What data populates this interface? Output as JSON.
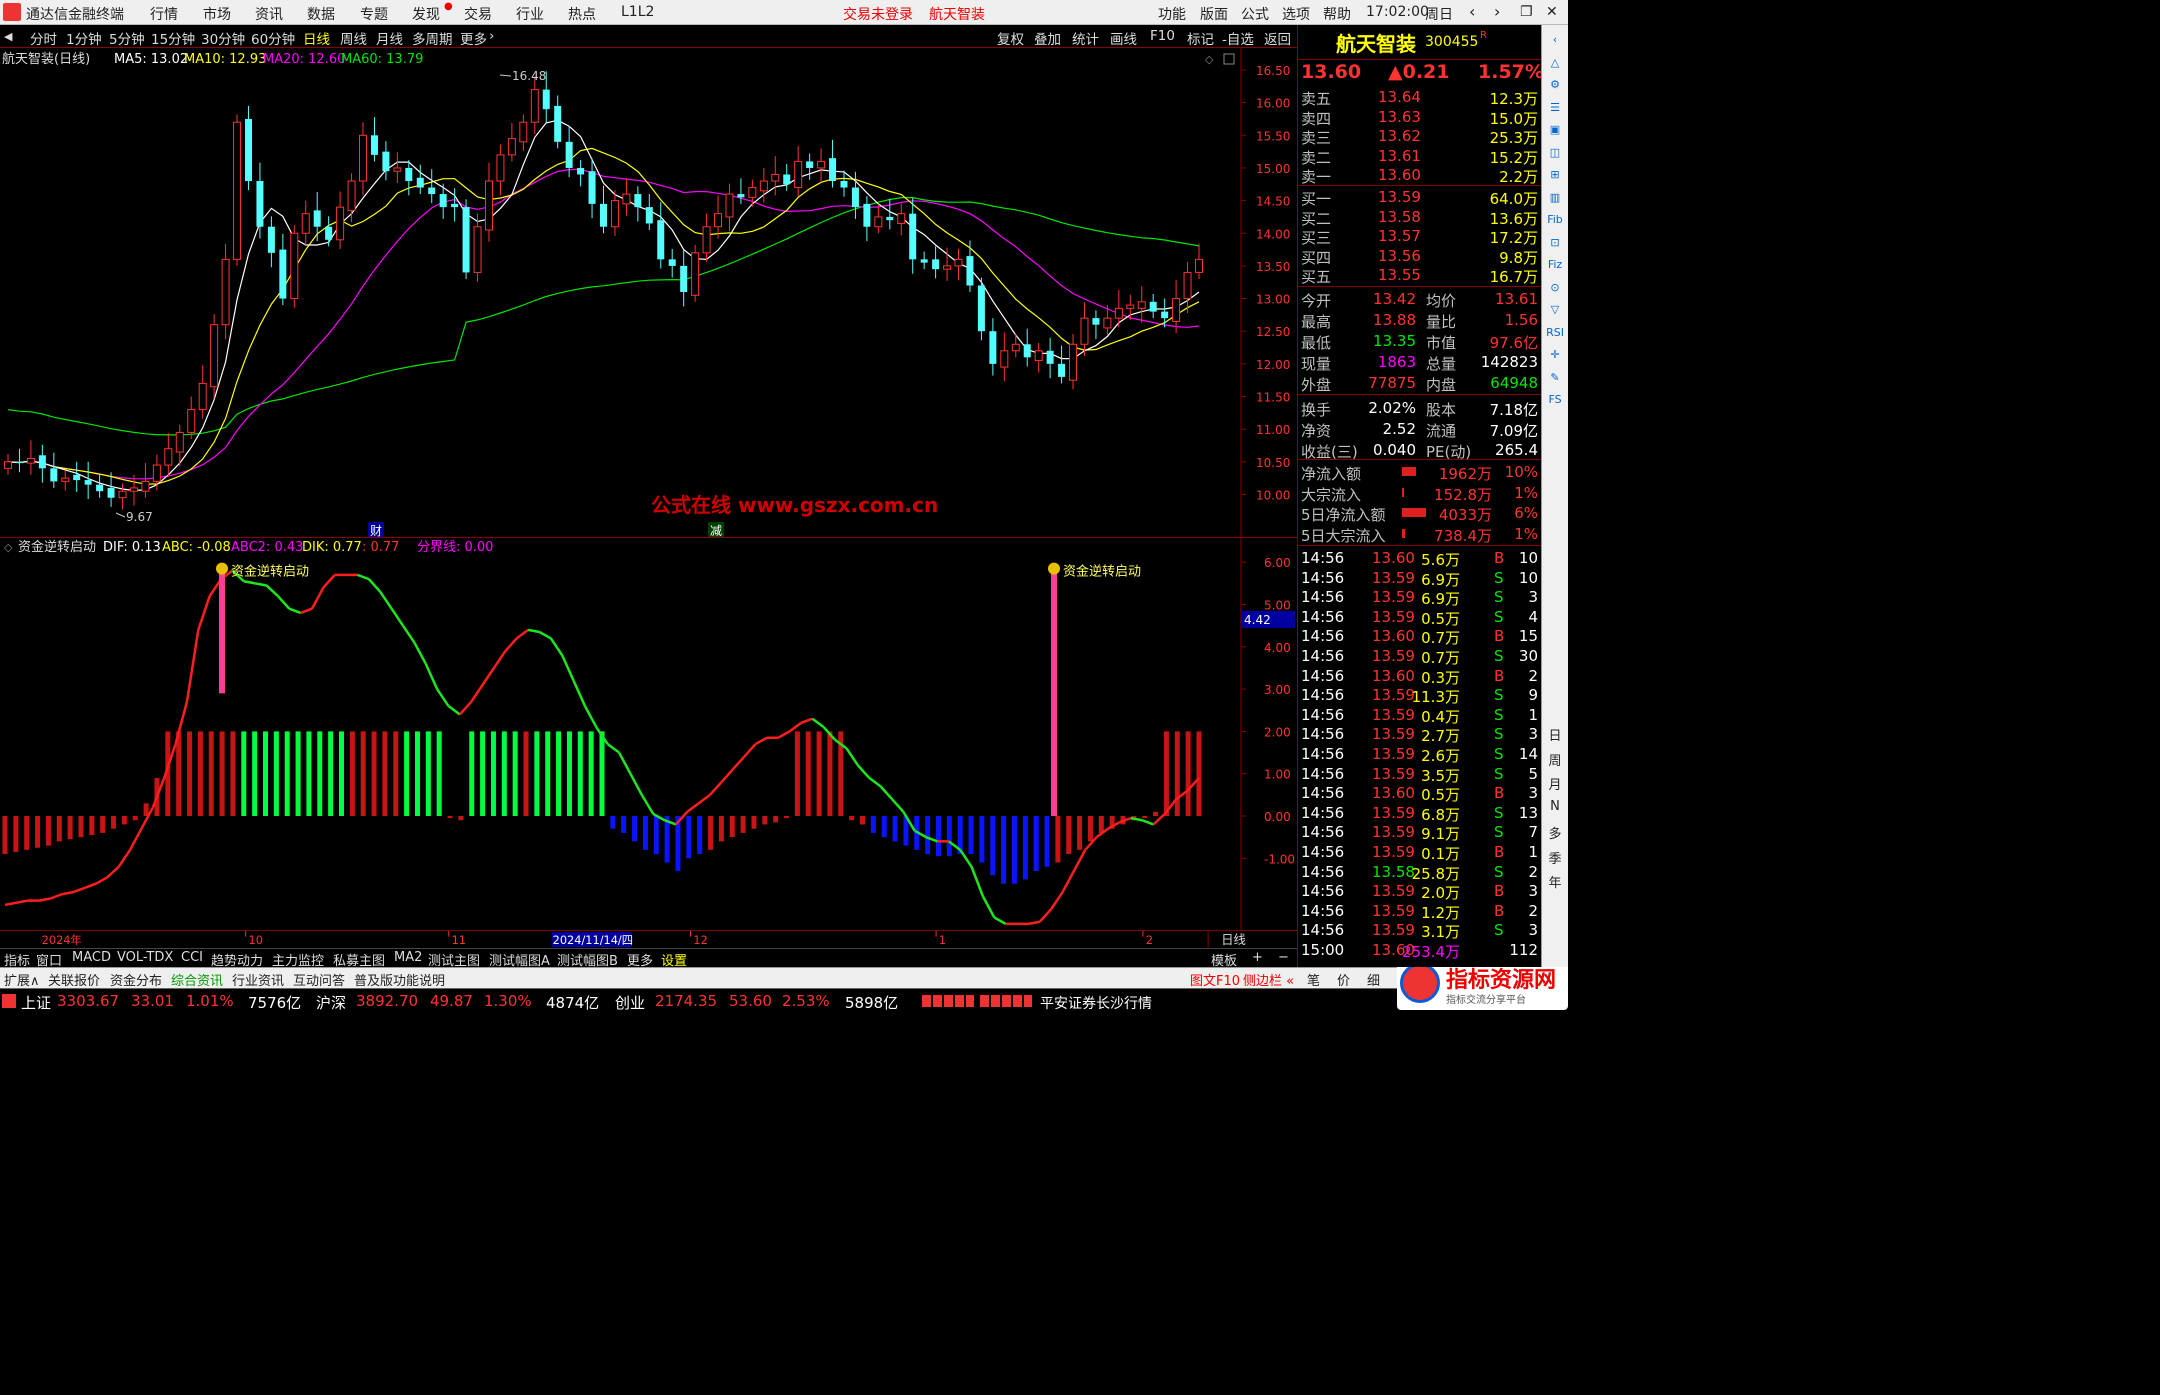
{
  "app": {
    "title": "通达信金融终端",
    "menu": [
      "行情",
      "市场",
      "资讯",
      "数据",
      "专题",
      "发现",
      "交易",
      "行业",
      "热点",
      "L1L2"
    ],
    "trade_login": "交易未登录",
    "stock_title": "航天智装",
    "right_menu": [
      "功能",
      "版面",
      "公式",
      "选项",
      "帮助"
    ],
    "time": "17:02:00",
    "weekday": "周日"
  },
  "periods": [
    "分时",
    "1分钟",
    "5分钟",
    "15分钟",
    "30分钟",
    "60分钟",
    "日线",
    "周线",
    "月线",
    "多周期",
    "更多"
  ],
  "active_period": "日线",
  "tools": [
    "复权",
    "叠加",
    "统计",
    "画线",
    "F10",
    "标记",
    "-自选",
    "返回"
  ],
  "main_chart": {
    "name": "航天智装(日线)",
    "ma5_label": "MA5: 13.02",
    "ma10_label": "MA10: 12.93",
    "ma20_label": "MA20: 12.60",
    "ma60_label": "MA60: 13.79",
    "high_label": "16.48",
    "low_label": "9.67",
    "y_ticks": [
      "16.50",
      "16.00",
      "15.50",
      "15.00",
      "14.50",
      "14.00",
      "13.50",
      "13.00",
      "12.50",
      "12.00",
      "11.50",
      "11.00",
      "10.50",
      "10.00"
    ],
    "markers": [
      "财",
      "减"
    ],
    "watermark": "公式在线  www.gszx.com.cn",
    "colors": {
      "up": "#ff3232",
      "down": "#54ffff",
      "ma5": "#ffffff",
      "ma10": "#ffff00",
      "ma20": "#ff00ff",
      "ma60": "#00e600"
    }
  },
  "sub_chart": {
    "name": "资金逆转启动",
    "dif": "DIF: 0.13",
    "abc": "ABC: -0.08",
    "abc2": "ABC2: 0.43",
    "dik": "DIK: 0.77",
    "val": ": 0.77",
    "fenjie": "分界线: 0.00",
    "signal_label": "资金逆转启动",
    "y_ticks": [
      "6.00",
      "5.00",
      "4.00",
      "3.00",
      "2.00",
      "1.00",
      "0.00",
      "-1.00"
    ],
    "current_value": "4.42"
  },
  "x_axis": {
    "labels": [
      "2024年",
      "10",
      "11",
      "2024/11/14/四",
      "12",
      "1",
      "2"
    ],
    "right_label": "日线"
  },
  "tabs1": [
    "指标",
    "窗口",
    "MACD",
    "VOL-TDX",
    "CCI",
    "趋势动力",
    "主力监控",
    "私募主图",
    "MA2",
    "测试主图",
    "测试幅图A",
    "测试幅图B",
    "更多",
    "设置"
  ],
  "tabs1_right": [
    "模板",
    "+",
    "−"
  ],
  "tabs2": [
    "扩展∧",
    "关联报价",
    "资金分布",
    "综合资讯",
    "行业资讯",
    "互动问答",
    "普及版功能说明"
  ],
  "tabs2_right": [
    "图文F10",
    "侧边栏 «",
    "笔",
    "价",
    "细"
  ],
  "status": {
    "sh_label": "上证",
    "sh_val": "3303.67",
    "sh_chg": "33.01",
    "sh_pct": "1.01%",
    "sh_amt": "7576亿",
    "sz_label": "沪深",
    "sz_val": "3892.70",
    "sz_chg": "49.87",
    "sz_pct": "1.30%",
    "sz_amt": "4874亿",
    "cy_label": "创业",
    "cy_val": "2174.35",
    "cy_chg": "53.60",
    "cy_pct": "2.53%",
    "cy_amt": "5898亿",
    "broker": "平安证券长沙行情"
  },
  "quote": {
    "name": "航天智装",
    "code": "300455",
    "price": "13.60",
    "change": "▲0.21",
    "pct": "1.57%",
    "asks": [
      {
        "label": "卖五",
        "price": "13.64",
        "vol": "12.3万"
      },
      {
        "label": "卖四",
        "price": "13.63",
        "vol": "15.0万"
      },
      {
        "label": "卖三",
        "price": "13.62",
        "vol": "25.3万"
      },
      {
        "label": "卖二",
        "price": "13.61",
        "vol": "15.2万"
      },
      {
        "label": "卖一",
        "price": "13.60",
        "vol": "2.2万"
      }
    ],
    "bids": [
      {
        "label": "买一",
        "price": "13.59",
        "vol": "64.0万"
      },
      {
        "label": "买二",
        "price": "13.58",
        "vol": "13.6万"
      },
      {
        "label": "买三",
        "price": "13.57",
        "vol": "17.2万"
      },
      {
        "label": "买四",
        "price": "13.56",
        "vol": "9.8万"
      },
      {
        "label": "买五",
        "price": "13.55",
        "vol": "16.7万"
      }
    ],
    "stats": [
      [
        "今开",
        "13.42",
        "均价",
        "13.61"
      ],
      [
        "最高",
        "13.88",
        "量比",
        "1.56"
      ],
      [
        "最低",
        "13.35",
        "市值",
        "97.6亿"
      ],
      [
        "现量",
        "1863",
        "总量",
        "142823"
      ],
      [
        "外盘",
        "77875",
        "内盘",
        "64948"
      ],
      [
        "换手",
        "2.02%",
        "股本",
        "7.18亿"
      ],
      [
        "净资",
        "2.52",
        "流通",
        "7.09亿"
      ],
      [
        "收益(三)",
        "0.040",
        "PE(动)",
        "265.4"
      ]
    ],
    "flows": [
      [
        "净流入额",
        "1962万",
        "10%"
      ],
      [
        "大宗流入",
        "152.8万",
        "1%"
      ],
      [
        "5日净流入额",
        "4033万",
        "6%"
      ],
      [
        "5日大宗流入",
        "738.4万",
        "1%"
      ]
    ],
    "ticks": [
      [
        "14:56",
        "13.60",
        "5.6万",
        "B",
        "10"
      ],
      [
        "14:56",
        "13.59",
        "6.9万",
        "S",
        "10"
      ],
      [
        "14:56",
        "13.59",
        "6.9万",
        "S",
        "3"
      ],
      [
        "14:56",
        "13.59",
        "0.5万",
        "S",
        "4"
      ],
      [
        "14:56",
        "13.60",
        "0.7万",
        "B",
        "15"
      ],
      [
        "14:56",
        "13.59",
        "0.7万",
        "S",
        "30"
      ],
      [
        "14:56",
        "13.60",
        "0.3万",
        "B",
        "2"
      ],
      [
        "14:56",
        "13.59",
        "11.3万",
        "S",
        "9"
      ],
      [
        "14:56",
        "13.59",
        "0.4万",
        "S",
        "1"
      ],
      [
        "14:56",
        "13.59",
        "2.7万",
        "S",
        "3"
      ],
      [
        "14:56",
        "13.59",
        "2.6万",
        "S",
        "14"
      ],
      [
        "14:56",
        "13.59",
        "3.5万",
        "S",
        "5"
      ],
      [
        "14:56",
        "13.60",
        "0.5万",
        "B",
        "3"
      ],
      [
        "14:56",
        "13.59",
        "6.8万",
        "S",
        "13"
      ],
      [
        "14:56",
        "13.59",
        "9.1万",
        "S",
        "7"
      ],
      [
        "14:56",
        "13.59",
        "0.1万",
        "B",
        "1"
      ],
      [
        "14:56",
        "13.58",
        "25.8万",
        "S",
        "2"
      ],
      [
        "14:56",
        "13.59",
        "2.0万",
        "B",
        "3"
      ],
      [
        "14:56",
        "13.59",
        "1.2万",
        "B",
        "2"
      ],
      [
        "14:56",
        "13.59",
        "3.1万",
        "S",
        "3"
      ],
      [
        "15:00",
        "13.60",
        "253.4万",
        "",
        "112"
      ]
    ]
  },
  "sidebar_right": [
    "日",
    "周",
    "月",
    "N",
    "多",
    "季",
    "年"
  ],
  "brand": {
    "name": "指标资源网",
    "sub": "指标交流分享平台"
  }
}
